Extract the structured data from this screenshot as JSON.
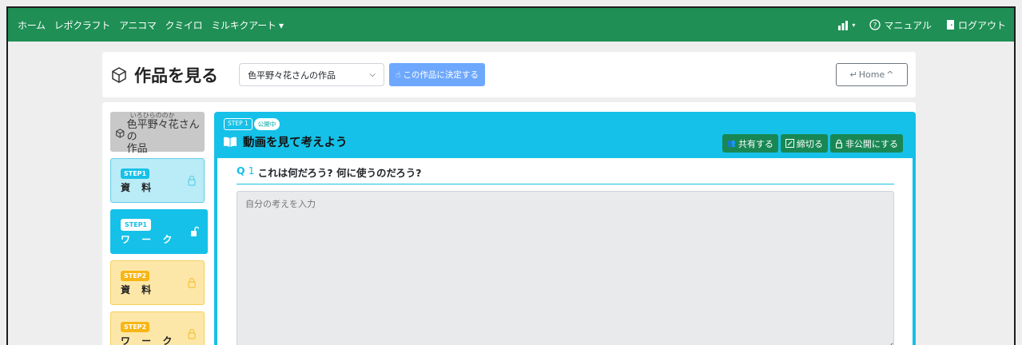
{
  "nav": {
    "items": [
      "ホーム",
      "レポクラフト",
      "アニコマ",
      "クミイロ",
      "ミルキクアート ▾"
    ],
    "stats_icon": "chart-icon",
    "manual": "マニュアル",
    "logout": "ログアウト"
  },
  "header": {
    "title": "作品を見る",
    "select_value": "色平野々花さんの作品",
    "decide_label": "この作品に決定する",
    "home_label": "Home"
  },
  "sidebar": {
    "ruby": "いろひらののか",
    "name": "色平野々花さんの",
    "suffix": "作品",
    "steps": [
      {
        "badge": "STEP1",
        "label": "資 料"
      },
      {
        "badge": "STEP1",
        "label": "ワ ー ク"
      },
      {
        "badge": "STEP2",
        "label": "資 料"
      },
      {
        "badge": "STEP2",
        "label": "ワ ー ク"
      }
    ]
  },
  "panel": {
    "step_tag": "STEP 1",
    "status_tag": "公開中",
    "title": "動画を見て考えよう",
    "actions": {
      "share": "共有する",
      "close": "締切る",
      "private": "非公開にする"
    },
    "question": {
      "label": "Q",
      "number": "1",
      "text": "これは何だろう? 何に使うのだろう?"
    },
    "answer_placeholder": "自分の考えを入力"
  },
  "colors": {
    "navbar": "#1f8f55",
    "accent_cyan": "#15c1e8",
    "step2_yellow": "#f7b614",
    "action_green": "#198754",
    "decide_blue": "#6ea8fe"
  }
}
